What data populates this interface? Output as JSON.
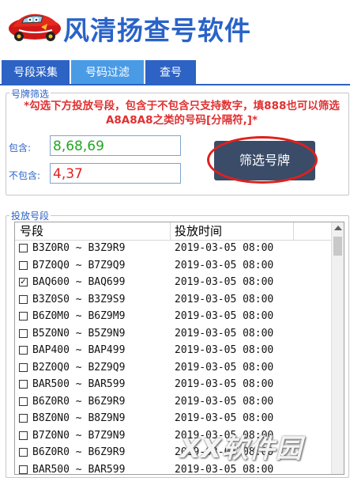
{
  "app": {
    "title": "风清扬查号软件"
  },
  "tabs": [
    {
      "label": "号段采集"
    },
    {
      "label": "号码过滤"
    },
    {
      "label": "查号"
    }
  ],
  "filter": {
    "group_title": "号牌筛选",
    "hint": "*勾选下方投放号段，包含于不包含只支持数字，填888也可以筛选A8A8A8之类的号码[分隔符,]*",
    "include_label": "包含:",
    "include_value": "8,68,69",
    "exclude_label": "不包含:",
    "exclude_value": "4,37",
    "button_label": "筛选号牌",
    "include_color": "#22a822",
    "exclude_color": "#e02020"
  },
  "segments": {
    "group_title": "投放号段",
    "columns": [
      "号段",
      "投放时间"
    ],
    "rows": [
      {
        "checked": false,
        "segment": "B3Z0R0 ~ B3Z9R9",
        "time": "2019-03-05 08:00"
      },
      {
        "checked": false,
        "segment": "B7Z0Q0 ~ B7Z9Q9",
        "time": "2019-03-05 08:00"
      },
      {
        "checked": true,
        "segment": "BAQ600 ~ BAQ699",
        "time": "2019-03-05 08:00"
      },
      {
        "checked": false,
        "segment": "B3Z0S0 ~ B3Z9S9",
        "time": "2019-03-05 08:00"
      },
      {
        "checked": false,
        "segment": "B6Z0M0 ~ B6Z9M9",
        "time": "2019-03-05 08:00"
      },
      {
        "checked": false,
        "segment": "B5Z0N0 ~ B5Z9N9",
        "time": "2019-03-05 08:00"
      },
      {
        "checked": false,
        "segment": "BAP400 ~ BAP499",
        "time": "2019-03-05 08:00"
      },
      {
        "checked": false,
        "segment": "B2Z0Q0 ~ B2Z9Q9",
        "time": "2019-03-05 08:00"
      },
      {
        "checked": false,
        "segment": "BAR500 ~ BAR599",
        "time": "2019-03-05 08:00"
      },
      {
        "checked": false,
        "segment": "B6Z0R0 ~ B6Z9R9",
        "time": "2019-03-05 08:00"
      },
      {
        "checked": false,
        "segment": "B8Z0N0 ~ B8Z9N9",
        "time": "2019-03-05 08:00"
      },
      {
        "checked": false,
        "segment": "B7Z0N0 ~ B7Z9N9",
        "time": "2019-03-05 08:00"
      },
      {
        "checked": false,
        "segment": "B6Z0R0 ~ B6Z9R9",
        "time": "2019-03-05 08:00"
      },
      {
        "checked": false,
        "segment": "BAR500 ~ BAR599",
        "time": "2019-03-05 08:00"
      }
    ]
  },
  "watermark": "XX软件园",
  "icons": {
    "logo": "red-race-car-icon",
    "scroll_up": "scroll-up-arrow-icon"
  }
}
